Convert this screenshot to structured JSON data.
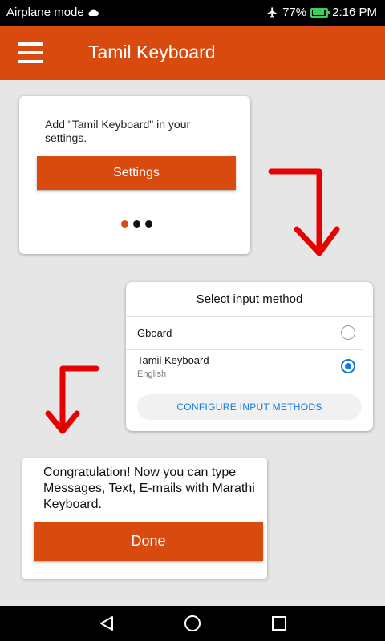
{
  "status_bar": {
    "mode": "Airplane mode",
    "battery": "77%",
    "time": "2:16 PM",
    "icons": [
      "cloud-icon",
      "airplane-icon",
      "battery-icon"
    ]
  },
  "app_bar": {
    "title": "Tamil Keyboard",
    "menu_icon": "hamburger-menu-icon"
  },
  "step1": {
    "text": "Add \"Tamil Keyboard\" in your settings.",
    "button": "Settings",
    "pager": {
      "count": 3,
      "active": 1
    }
  },
  "step2": {
    "title": "Select input method",
    "options": [
      {
        "label": "Gboard",
        "sub": "",
        "selected": false
      },
      {
        "label": "Tamil Keyboard",
        "sub": "English",
        "selected": true
      }
    ],
    "configure": "CONFIGURE INPUT METHODS"
  },
  "step3": {
    "text": "Congratulation! Now you can type Messages, Text, E-mails with Marathi Keyboard.",
    "button": "Done"
  },
  "nav_bar": {
    "icons": [
      "back-icon",
      "home-icon",
      "recents-icon"
    ]
  },
  "colors": {
    "accent": "#d84a0d",
    "radio_selected": "#1479d6",
    "arrow": "#e60000",
    "background": "#e6e6e6"
  }
}
